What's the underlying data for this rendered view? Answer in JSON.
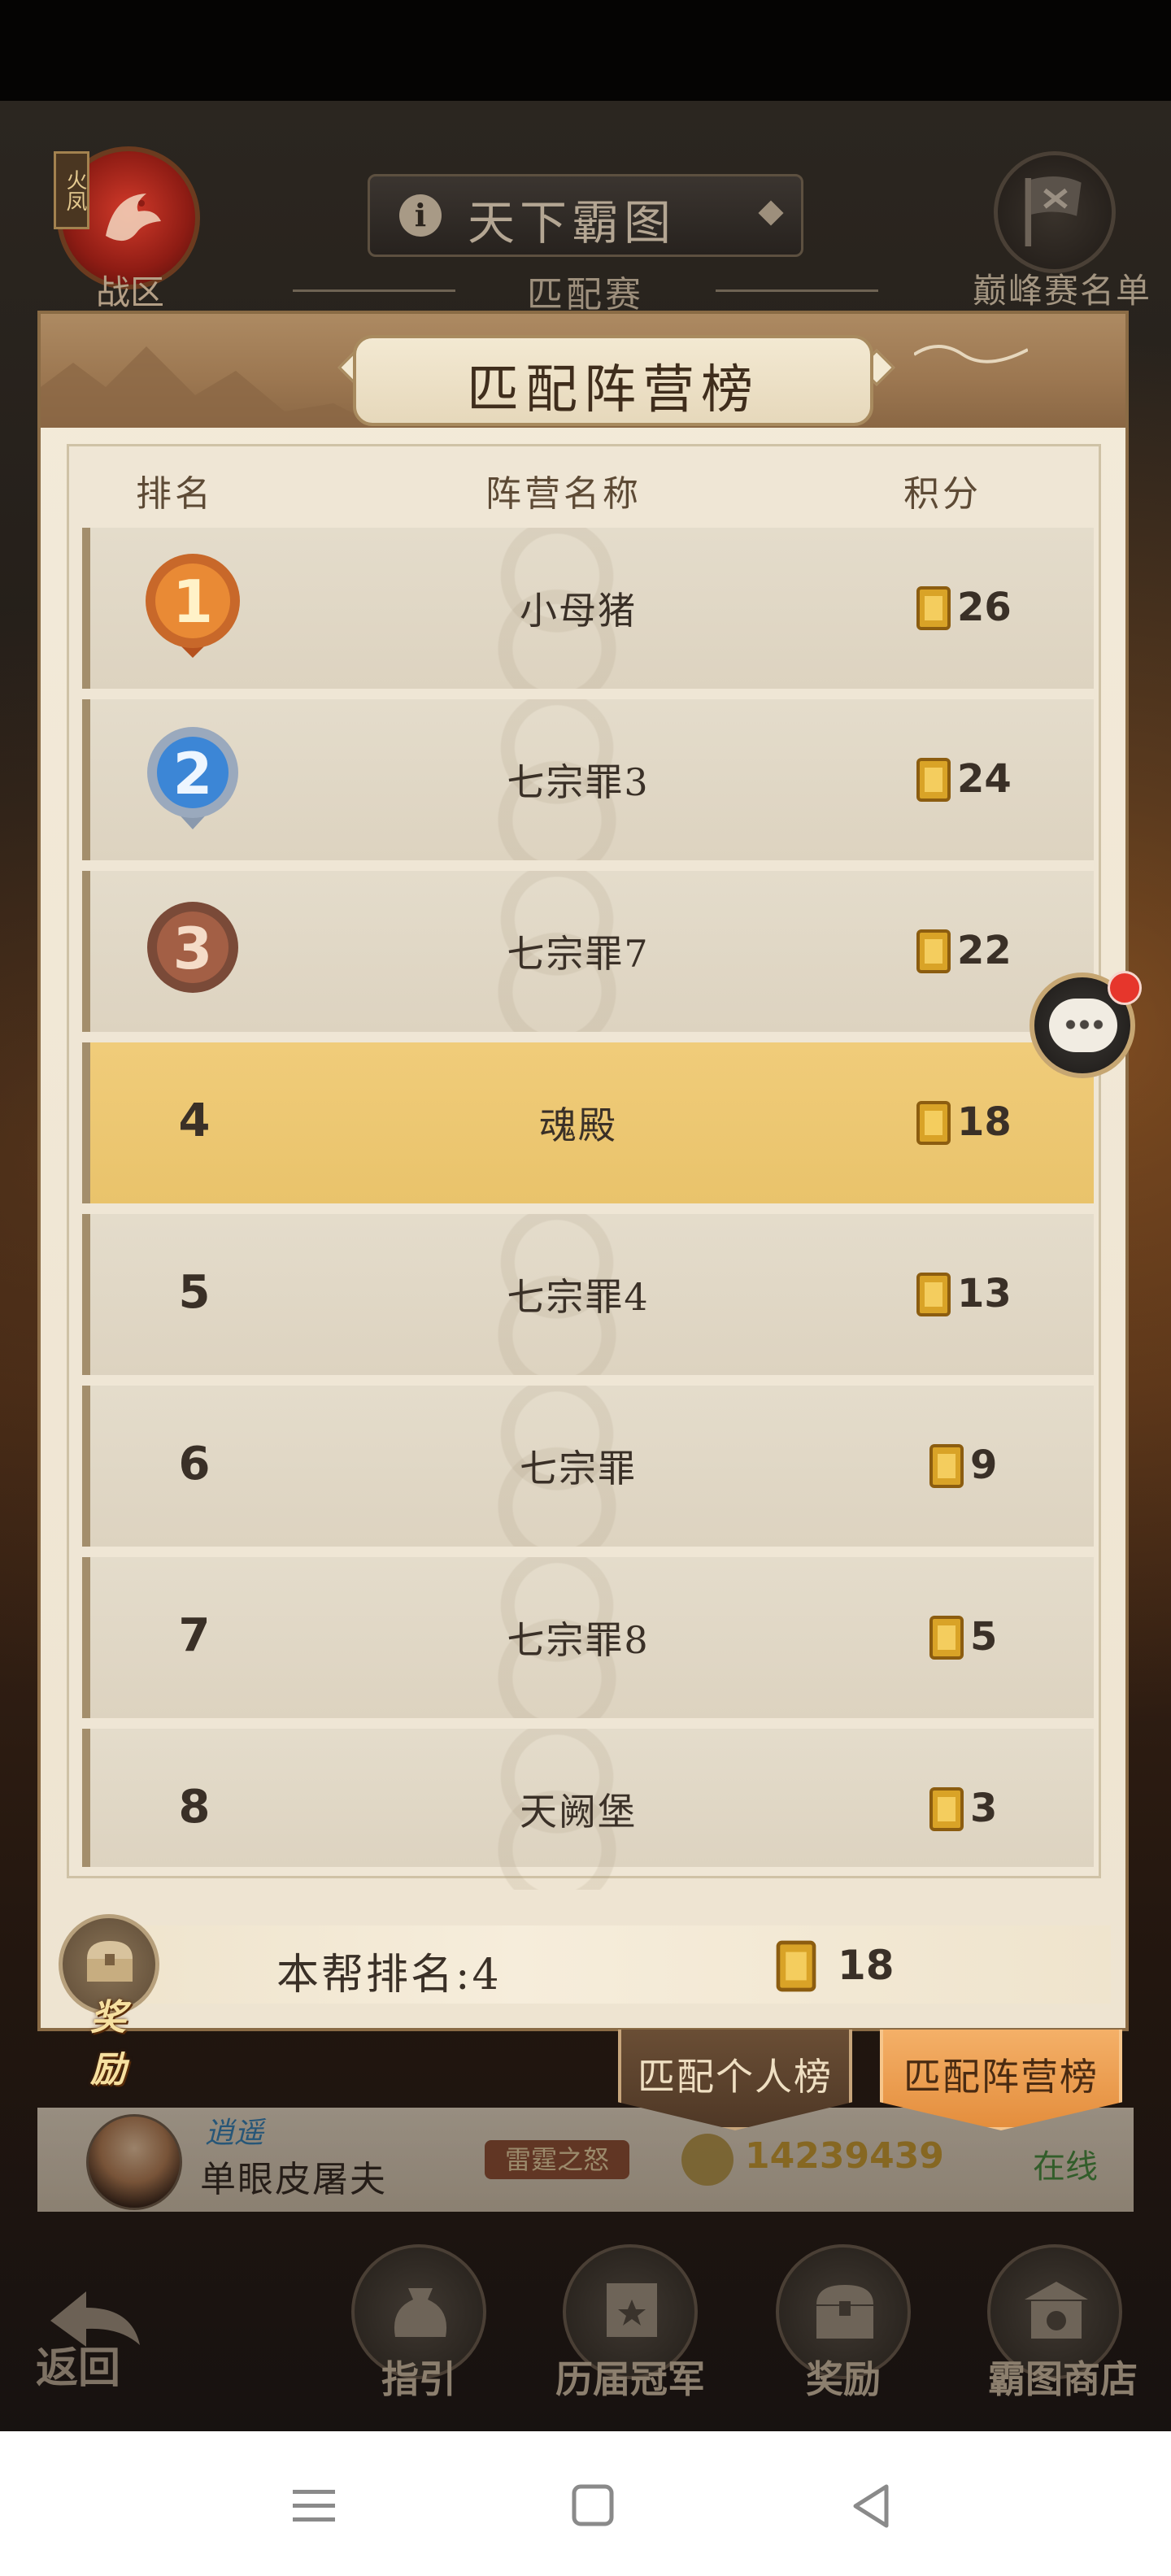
{
  "top": {
    "zone_tag": "火凤",
    "zone_label": "战区",
    "title": "天下霸图",
    "subtitle": "匹配赛",
    "peak_label": "巅峰赛名单"
  },
  "modal": {
    "title": "匹配阵营榜",
    "headers": {
      "rank": "排名",
      "camp": "阵营名称",
      "score": "积分"
    },
    "rows": [
      {
        "rank": "1",
        "name": "小母猪",
        "score": "26",
        "medal": "gold"
      },
      {
        "rank": "2",
        "name": "七宗罪3",
        "score": "24",
        "medal": "silver"
      },
      {
        "rank": "3",
        "name": "七宗罪7",
        "score": "22",
        "medal": "bronze"
      },
      {
        "rank": "4",
        "name": "魂殿",
        "score": "18"
      },
      {
        "rank": "5",
        "name": "七宗罪4",
        "score": "13"
      },
      {
        "rank": "6",
        "name": "七宗罪",
        "score": "9"
      },
      {
        "rank": "7",
        "name": "七宗罪8",
        "score": "5"
      },
      {
        "rank": "8",
        "name": "天阙堡",
        "score": "3"
      }
    ],
    "own_rank": "本帮排名:4",
    "own_score": "18",
    "reward_label": "奖励",
    "highlight_color": "#ecc672"
  },
  "tabs": {
    "personal": "匹配个人榜",
    "camp": "匹配阵营榜"
  },
  "bg_player": {
    "title_tag": "逍遥",
    "name": "单眼皮屠夫",
    "guild": "雷霆之怒",
    "power": "14239439",
    "status": "在线"
  },
  "bottom_nav": {
    "back": "返回",
    "guide": "指引",
    "champions": "历届冠军",
    "rewards": "奖励",
    "shop": "霸图商店"
  },
  "icons": [
    "bird-emblem-icon",
    "info-icon",
    "flag-icon",
    "gold-medal-icon",
    "silver-medal-icon",
    "bronze-medal-icon",
    "token-icon",
    "chest-icon",
    "chat-icon",
    "back-arrow-icon",
    "bag-icon",
    "trophy-icon",
    "gate-icon",
    "menu-icon",
    "home-icon",
    "back-icon"
  ]
}
